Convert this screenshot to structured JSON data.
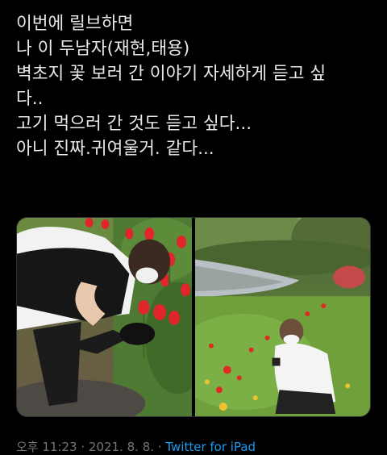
{
  "tweet": {
    "lines": [
      "이번에 릴브하면",
      "나 이 두남자(재현,태용)",
      "벽초지 꽃 보러 간 이야기 자세하게 듣고 싶",
      "다..",
      "고기 먹으러 간 것도 듣고 싶다...",
      "아니 진짜.귀여울거. 같다..."
    ]
  },
  "media": [
    {
      "icon": "photo-crouching-man-tulips"
    },
    {
      "icon": "photo-man-photographing-tulips-by-pond"
    }
  ],
  "meta": {
    "time": "오후 11:23",
    "separator1": " · ",
    "date": "2021. 8. 8.",
    "separator2": " · ",
    "source": "Twitter for iPad"
  },
  "colors": {
    "background": "#000000",
    "text": "#e7e9ea",
    "muted": "#71767b",
    "link": "#1d9bf0"
  }
}
